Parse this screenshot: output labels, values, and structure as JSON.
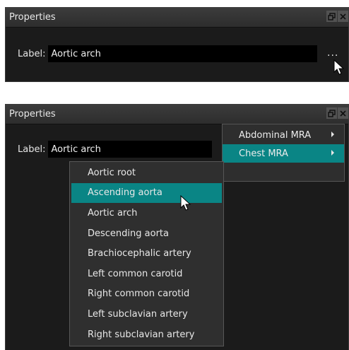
{
  "panel1": {
    "title": "Properties",
    "label_caption": "Label:",
    "label_value": "Aortic arch",
    "ellipsis": "...",
    "title_buttons": {
      "float": "🗗",
      "close": "✕"
    }
  },
  "panel2": {
    "title": "Properties",
    "label_caption": "Label:",
    "label_value": "Aortic arch",
    "title_buttons": {
      "float": "🗗",
      "close": "✕"
    },
    "submenu": [
      {
        "label": "Abdominal MRA"
      },
      {
        "label": "Chest MRA"
      }
    ],
    "menu": [
      {
        "label": "Aortic root"
      },
      {
        "label": "Ascending aorta"
      },
      {
        "label": "Aortic arch"
      },
      {
        "label": "Descending aorta"
      },
      {
        "label": "Brachiocephalic artery"
      },
      {
        "label": "Left common carotid"
      },
      {
        "label": "Right common carotid"
      },
      {
        "label": "Left subclavian artery"
      },
      {
        "label": "Right subclavian artery"
      }
    ]
  },
  "colors": {
    "accent": "#0a8585",
    "panel_bg": "#1b1b1b",
    "menu_bg": "#2f2f2f"
  },
  "icons": {
    "cursor": "arrow-cursor-icon",
    "submenu_arrow": "chevron-right-icon"
  }
}
